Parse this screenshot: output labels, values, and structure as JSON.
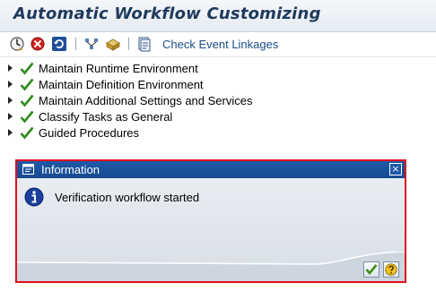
{
  "window": {
    "title": "Automatic Workflow Customizing"
  },
  "toolbar": {
    "icons": [
      "execute-icon",
      "stop-icon",
      "refresh-icon",
      "hierarchy-icon",
      "transport-icon",
      "document-icon"
    ],
    "link_label": "Check Event Linkages"
  },
  "tree": {
    "items": [
      {
        "label": "Maintain Runtime Environment",
        "status": "check-icon"
      },
      {
        "label": "Maintain Definition Environment",
        "status": "check-icon"
      },
      {
        "label": "Maintain Additional Settings and Services",
        "status": "check-icon"
      },
      {
        "label": "Classify Tasks as General",
        "status": "check-icon"
      },
      {
        "label": "Guided Procedures",
        "status": "check-icon"
      }
    ]
  },
  "dialog": {
    "title": "Information",
    "message": "Verification workflow started",
    "close_glyph": "×",
    "buttons": [
      "confirm-icon",
      "help-icon"
    ],
    "accent": "#e0101e",
    "header_color": "#1d5aa8"
  }
}
